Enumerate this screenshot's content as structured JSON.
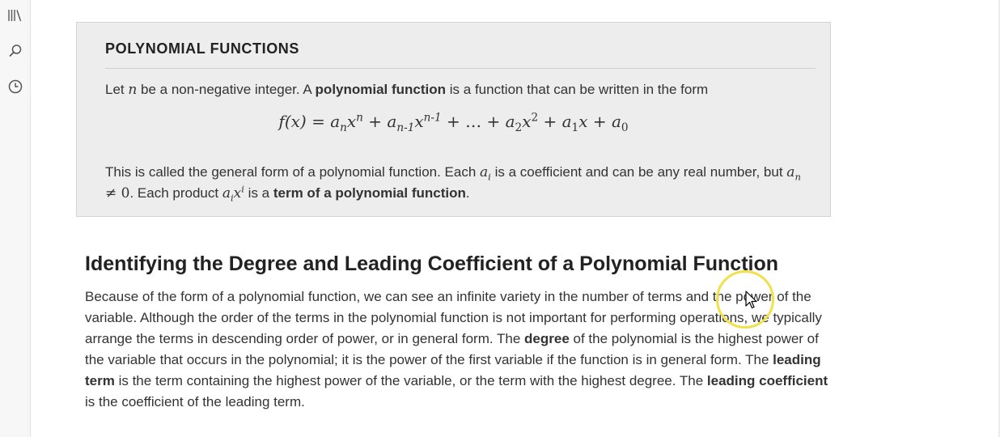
{
  "sidebar": {
    "items": [
      {
        "icon": "library-icon"
      },
      {
        "icon": "search-icon"
      },
      {
        "icon": "history-clock-icon"
      }
    ]
  },
  "callout": {
    "title": "POLYNOMIAL FUNCTIONS",
    "line1": {
      "pre": "Let ",
      "var_n": "n",
      "mid": " be a non-negative integer. A ",
      "bold": "polynomial function",
      "post": " is a function that can be written in the form"
    },
    "formula": {
      "lhs": "f(x) = ",
      "t1_a": "a",
      "t1_sub": "n",
      "t1_x": "x",
      "t1_sup": "n",
      "plus1": " + ",
      "t2_a": "a",
      "t2_sub": "n-1",
      "t2_x": "x",
      "t2_sup": "n-1",
      "plus2": " + … + ",
      "t3_a": "a",
      "t3_sub": "2",
      "t3_x": "x",
      "t3_sup": "2",
      "plus3": " + ",
      "t4_a": "a",
      "t4_sub": "1",
      "t4_x": "x",
      "plus4": " + ",
      "t5_a": "a",
      "t5_sub": "0"
    },
    "para": {
      "p1": "This is called the general form of a polynomial function. Each ",
      "ai_a": "a",
      "ai_sub": "i",
      "p2": " is a coefficient and can be any real number, but ",
      "an_a": "a",
      "an_sub": "n",
      "neq": " ≠ 0",
      "p3": ". Each product ",
      "term_a": "a",
      "term_sub": "i",
      "term_x": "x",
      "term_sup": "i",
      "p4": " is a ",
      "bold": "term of a polynomial function",
      "p5": "."
    }
  },
  "section": {
    "heading": "Identifying the Degree and Leading Coefficient of a Polynomial Function",
    "body": {
      "s1": "Because of the form of a polynomial function, we can see an infinite variety in the number of terms and the power of the variable. Although the order of the terms in the polynomial function is not important for performing operations, we typically arrange the terms in descending order of power, or in general form. The ",
      "b1": "degree",
      "s2": " of the polynomial is the highest power of the variable that occurs in the polynomial; it is the power of the first variable if the function is in general form. The ",
      "b2": "leading term",
      "s3": " is the term containing the highest power of the variable, or the term with the highest degree. The ",
      "b3": "leading coefficient",
      "s4": " is the coefficient of the leading term."
    }
  },
  "colors": {
    "callout_bg": "#ededed",
    "cursor_highlight": "#f2e04a"
  }
}
